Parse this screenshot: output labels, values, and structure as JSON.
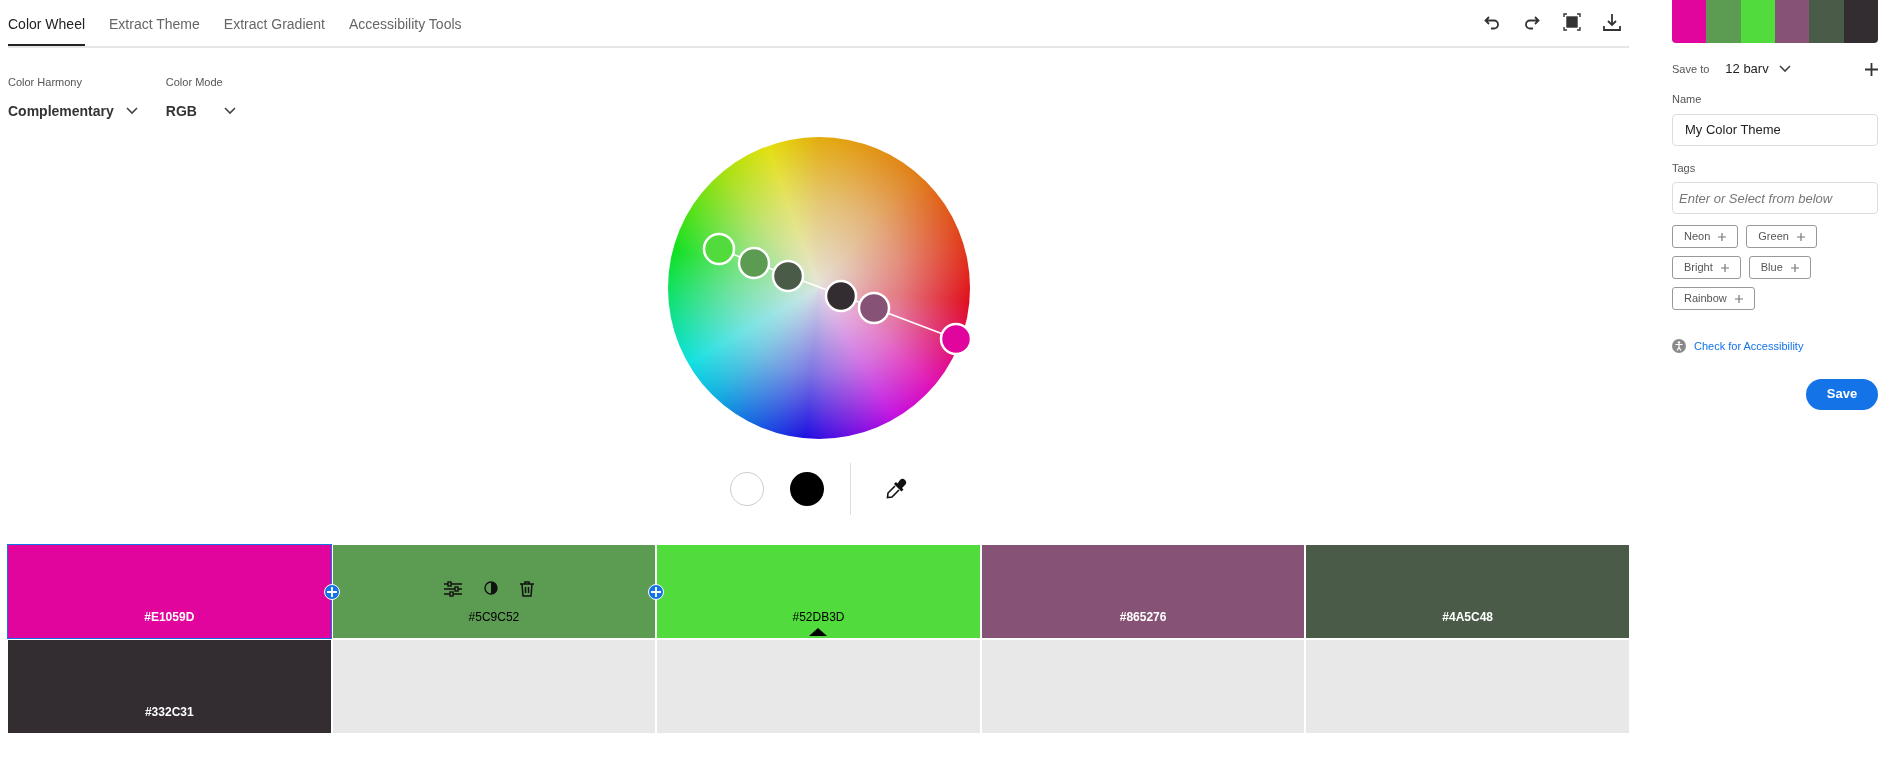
{
  "tabs": [
    {
      "label": "Color Wheel",
      "selected": true
    },
    {
      "label": "Extract Theme",
      "selected": false
    },
    {
      "label": "Extract Gradient",
      "selected": false
    },
    {
      "label": "Accessibility Tools",
      "selected": false
    }
  ],
  "controls": [
    {
      "label": "Color Harmony",
      "value": "Complementary"
    },
    {
      "label": "Color Mode",
      "value": "RGB"
    }
  ],
  "swatches": [
    {
      "color": "#e1059d",
      "hex": "#E1059D",
      "selected": true,
      "hovered": false,
      "base": false
    },
    {
      "color": "#5c9c52",
      "hex": "#5C9C52",
      "selected": false,
      "hovered": true,
      "base": false
    },
    {
      "color": "#52db3d",
      "hex": "#52DB3D",
      "selected": false,
      "hovered": false,
      "base": true
    },
    {
      "color": "#865276",
      "hex": "#865276",
      "selected": false,
      "hovered": false,
      "base": false
    },
    {
      "color": "#4a5c48",
      "hex": "#4A5C48",
      "selected": false,
      "hovered": false,
      "base": false
    },
    {
      "color": "#332c31",
      "hex": "#332C31",
      "selected": false,
      "hovered": false,
      "base": false
    }
  ],
  "sidebar": {
    "save_to_label": "Save to",
    "library": "12 barv",
    "name_label": "Name",
    "name_value": "My Color Theme",
    "tags_label": "Tags",
    "tags_placeholder": "Enter or Select from below",
    "tags": [
      "Neon",
      "Green",
      "Bright",
      "Blue",
      "Rainbow"
    ],
    "accessibility_link": "Check for Accessibility",
    "save_button": "Save"
  }
}
